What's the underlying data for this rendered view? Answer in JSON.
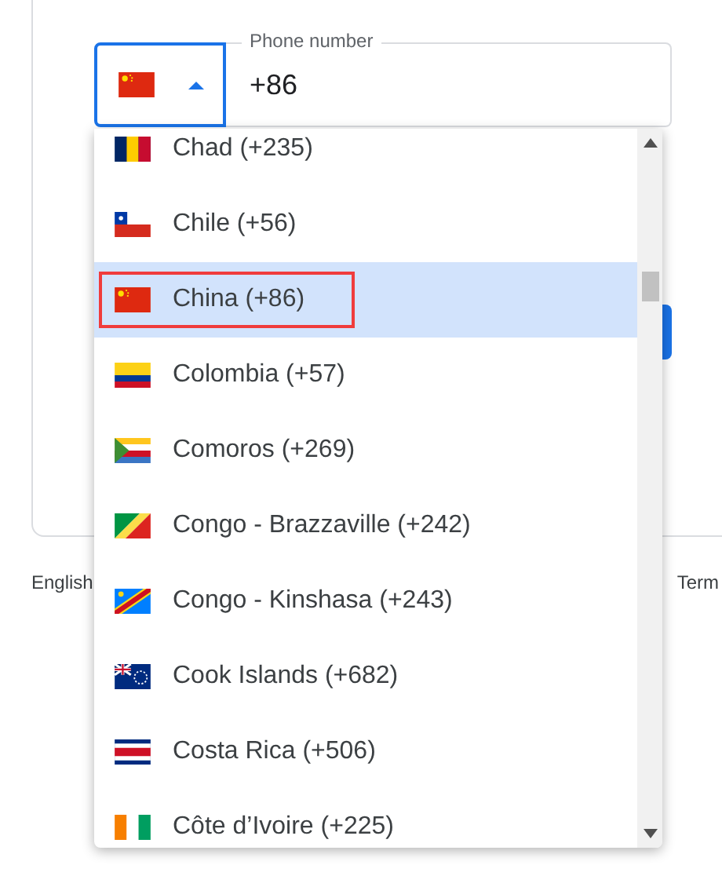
{
  "phone_field": {
    "label": "Phone number",
    "value": "+86"
  },
  "country_picker": {
    "expanded": true
  },
  "countries": [
    {
      "name": "Chad (+235)",
      "selected": false,
      "highlighted": false
    },
    {
      "name": "Chile (+56)",
      "selected": false,
      "highlighted": false
    },
    {
      "name": "China (+86)",
      "selected": true,
      "highlighted": true
    },
    {
      "name": "Colombia (+57)",
      "selected": false,
      "highlighted": false
    },
    {
      "name": "Comoros (+269)",
      "selected": false,
      "highlighted": false
    },
    {
      "name": "Congo - Brazzaville (+242)",
      "selected": false,
      "highlighted": false
    },
    {
      "name": "Congo - Kinshasa (+243)",
      "selected": false,
      "highlighted": false
    },
    {
      "name": "Cook Islands (+682)",
      "selected": false,
      "highlighted": false
    },
    {
      "name": "Costa Rica (+506)",
      "selected": false,
      "highlighted": false
    },
    {
      "name": "Côte d’Ivoire (+225)",
      "selected": false,
      "highlighted": false
    }
  ],
  "footer": {
    "language": "English",
    "link": "Term"
  }
}
